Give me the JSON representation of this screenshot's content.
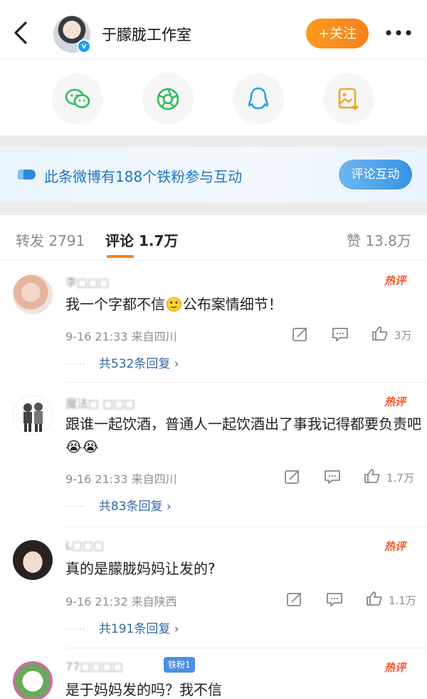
{
  "header": {
    "user_name": "于朦胧工作室",
    "follow_label": "+关注",
    "verified_mark": "v"
  },
  "share": {
    "items": [
      "wechat-icon",
      "moments-icon",
      "qq-icon",
      "save-image-icon"
    ]
  },
  "fan_banner": {
    "text": "此条微博有188个铁粉参与互动",
    "button_label": "评论互动"
  },
  "tabs": {
    "repost": "转发 2791",
    "comments": "评论 1.7万",
    "likes": "赞 13.8万"
  },
  "colors": {
    "accent_orange": "#f7811c",
    "link_blue": "#3568a4",
    "hot_red": "#f4562a",
    "banner_blue": "#1d74c7"
  },
  "comments": [
    {
      "username": "李□□□",
      "hot_label": "热评",
      "text": "我一个字都不信🙂公布案情细节！",
      "meta": "9-16 21:33  来自四川",
      "likes": "3万",
      "replies": "共532条回复 ›"
    },
    {
      "username": "魔法□ □□□",
      "hot_label": "热评",
      "text": "跟谁一起饮酒，普通人一起饮酒出了事我记得都要负责吧😭😭",
      "meta": "9-16 21:33  来自四川",
      "likes": "1.7万",
      "replies": "共83条回复 ›"
    },
    {
      "username": "L□□□",
      "hot_label": "热评",
      "text": "真的是朦胧妈妈让发的?",
      "meta": "9-16 21:32  来自陕西",
      "likes": "1.1万",
      "replies": "共191条回复 ›"
    },
    {
      "username": "77□□□□",
      "hot_label": "热评",
      "fan_badge": "铁粉1",
      "text": "是于妈妈发的吗？我不信"
    }
  ]
}
